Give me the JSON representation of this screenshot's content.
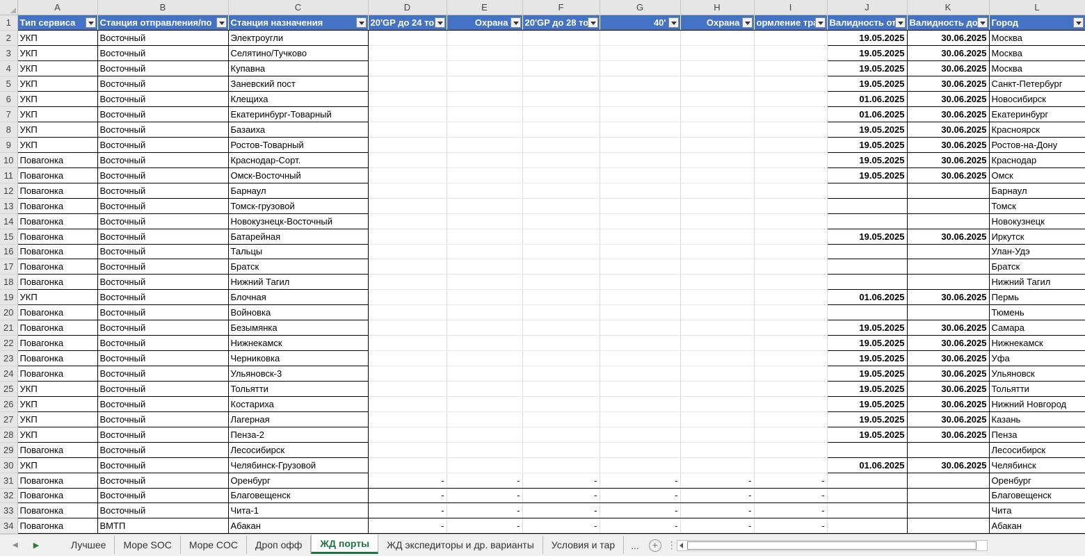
{
  "columns": [
    "A",
    "B",
    "C",
    "D",
    "E",
    "F",
    "G",
    "H",
    "I",
    "J",
    "K",
    "L"
  ],
  "header": [
    "Тип сервиса",
    "Станция отправления/по",
    "Станция назначения",
    "20'GP до 24 то",
    "Охрана",
    "20'GP до 28 то",
    "40'",
    "Охрана",
    "ормление тра",
    "Валидность от",
    "Валидность до",
    "Город"
  ],
  "rows": [
    {
      "n": "2",
      "a": "УКП",
      "b": "Восточный",
      "c": "Электроугли",
      "j": "19.05.2025",
      "k": "30.06.2025",
      "l": "Москва"
    },
    {
      "n": "3",
      "a": "УКП",
      "b": "Восточный",
      "c": "Селятино/Тучково",
      "j": "19.05.2025",
      "k": "30.06.2025",
      "l": "Москва"
    },
    {
      "n": "4",
      "a": "УКП",
      "b": "Восточный",
      "c": "Купавна",
      "j": "19.05.2025",
      "k": "30.06.2025",
      "l": "Москва"
    },
    {
      "n": "5",
      "a": "УКП",
      "b": "Восточный",
      "c": "Заневский пост",
      "j": "19.05.2025",
      "k": "30.06.2025",
      "l": "Санкт-Петербург"
    },
    {
      "n": "6",
      "a": "УКП",
      "b": "Восточный",
      "c": "Клещиха",
      "j": "01.06.2025",
      "k": "30.06.2025",
      "l": "Новосибирск"
    },
    {
      "n": "7",
      "a": "УКП",
      "b": "Восточный",
      "c": "Екатеринбург-Товарный",
      "j": "01.06.2025",
      "k": "30.06.2025",
      "l": "Екатеринбург"
    },
    {
      "n": "8",
      "a": "УКП",
      "b": "Восточный",
      "c": "Базаиха",
      "j": "19.05.2025",
      "k": "30.06.2025",
      "l": "Красноярск"
    },
    {
      "n": "9",
      "a": "УКП",
      "b": "Восточный",
      "c": "Ростов-Товарный",
      "j": "19.05.2025",
      "k": "30.06.2025",
      "l": "Ростов-на-Дону"
    },
    {
      "n": "10",
      "a": "Повагонка",
      "b": "Восточный",
      "c": "Краснодар-Сорт.",
      "j": "19.05.2025",
      "k": "30.06.2025",
      "l": "Краснодар"
    },
    {
      "n": "11",
      "a": "Повагонка",
      "b": "Восточный",
      "c": "Омск-Восточный",
      "j": "19.05.2025",
      "k": "30.06.2025",
      "l": "Омск"
    },
    {
      "n": "12",
      "a": "Повагонка",
      "b": "Восточный",
      "c": "Барнаул",
      "j": "",
      "k": "",
      "l": "Барнаул"
    },
    {
      "n": "13",
      "a": "Повагонка",
      "b": "Восточный",
      "c": "Томск-грузовой",
      "j": "",
      "k": "",
      "l": "Томск"
    },
    {
      "n": "14",
      "a": "Повагонка",
      "b": "Восточный",
      "c": "Новокузнецк-Восточный",
      "j": "",
      "k": "",
      "l": "Новокузнецк"
    },
    {
      "n": "15",
      "a": "Повагонка",
      "b": "Восточный",
      "c": "Батарейная",
      "j": "19.05.2025",
      "k": "30.06.2025",
      "l": "Иркутск"
    },
    {
      "n": "16",
      "a": "Повагонка",
      "b": "Восточный",
      "c": "Тальцы",
      "j": "",
      "k": "",
      "l": "Улан-Удэ"
    },
    {
      "n": "17",
      "a": "Повагонка",
      "b": "Восточный",
      "c": "Братск",
      "j": "",
      "k": "",
      "l": "Братск"
    },
    {
      "n": "18",
      "a": "Повагонка",
      "b": "Восточный",
      "c": "Нижний Тагил",
      "j": "",
      "k": "",
      "l": "Нижний Тагил"
    },
    {
      "n": "19",
      "a": "УКП",
      "b": "Восточный",
      "c": "Блочная",
      "j": "01.06.2025",
      "k": "30.06.2025",
      "l": "Пермь"
    },
    {
      "n": "20",
      "a": "Повагонка",
      "b": "Восточный",
      "c": "Войновка",
      "j": "",
      "k": "",
      "l": "Тюмень"
    },
    {
      "n": "21",
      "a": "Повагонка",
      "b": "Восточный",
      "c": "Безымянка",
      "j": "19.05.2025",
      "k": "30.06.2025",
      "l": "Самара"
    },
    {
      "n": "22",
      "a": "Повагонка",
      "b": "Восточный",
      "c": "Нижнекамск",
      "j": "19.05.2025",
      "k": "30.06.2025",
      "l": "Нижнекамск"
    },
    {
      "n": "23",
      "a": "Повагонка",
      "b": "Восточный",
      "c": "Черниковка",
      "j": "19.05.2025",
      "k": "30.06.2025",
      "l": "Уфа"
    },
    {
      "n": "24",
      "a": "Повагонка",
      "b": "Восточный",
      "c": "Ульяновск-3",
      "j": "19.05.2025",
      "k": "30.06.2025",
      "l": "Ульяновск"
    },
    {
      "n": "25",
      "a": "УКП",
      "b": "Восточный",
      "c": "Тольятти",
      "j": "19.05.2025",
      "k": "30.06.2025",
      "l": "Тольятти"
    },
    {
      "n": "26",
      "a": "УКП",
      "b": "Восточный",
      "c": "Костариха",
      "j": "19.05.2025",
      "k": "30.06.2025",
      "l": "Нижний Новгород"
    },
    {
      "n": "27",
      "a": "УКП",
      "b": "Восточный",
      "c": "Лагерная",
      "j": "19.05.2025",
      "k": "30.06.2025",
      "l": "Казань"
    },
    {
      "n": "28",
      "a": "УКП",
      "b": "Восточный",
      "c": "Пенза-2",
      "j": "19.05.2025",
      "k": "30.06.2025",
      "l": "Пенза"
    },
    {
      "n": "29",
      "a": "Повагонка",
      "b": "Восточный",
      "c": "Лесосибирск",
      "j": "",
      "k": "",
      "l": "Лесосибирск"
    },
    {
      "n": "30",
      "a": "УКП",
      "b": "Восточный",
      "c": "Челябинск-Грузовой",
      "j": "01.06.2025",
      "k": "30.06.2025",
      "l": "Челябинск"
    },
    {
      "n": "31",
      "a": "Повагонка",
      "b": "Восточный",
      "c": "Оренбург",
      "j": "",
      "k": "",
      "l": "Оренбург",
      "dash": true
    },
    {
      "n": "32",
      "a": "Повагонка",
      "b": "Восточный",
      "c": "Благовещенск",
      "j": "",
      "k": "",
      "l": "Благовещенск",
      "dash": true
    },
    {
      "n": "33",
      "a": "Повагонка",
      "b": "Восточный",
      "c": "Чита-1",
      "j": "",
      "k": "",
      "l": "Чита",
      "dash": true
    },
    {
      "n": "34",
      "a": "Повагонка",
      "b": "ВМТП",
      "c": "Абакан",
      "j": "",
      "k": "",
      "l": "Абакан",
      "dash": true
    }
  ],
  "dash_symbol": "-",
  "tabs": {
    "items": [
      "Лучшее",
      "Море SOC",
      "Море COC",
      "Дроп офф",
      "ЖД порты",
      "ЖД экспедиторы и др. варианты",
      "Условия и тар"
    ],
    "active_index": 4,
    "more_label": "...",
    "add_label": "+"
  },
  "colors": {
    "header_fill": "#4472c4",
    "active_tab": "#1e7145"
  }
}
